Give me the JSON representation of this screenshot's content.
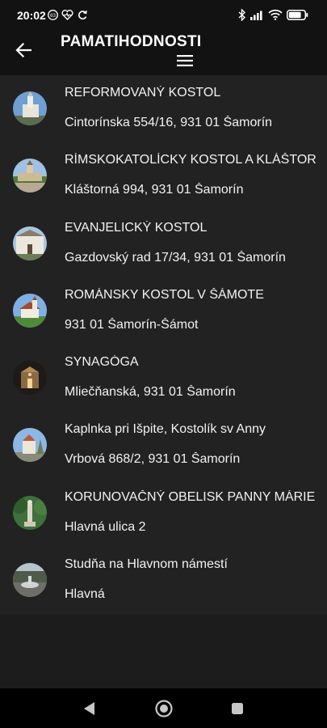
{
  "status_bar": {
    "time": "20:02",
    "notification_badge": "63",
    "battery_level": 0.8,
    "icons": [
      "heart-pulse-icon",
      "sync-icon",
      "bluetooth-icon",
      "signal-icon",
      "wifi-icon",
      "battery-icon"
    ]
  },
  "app_bar": {
    "title": "PAMATIHODNOSTI",
    "back_icon": "arrow-left-icon",
    "menu_icon": "hamburger-menu-icon"
  },
  "places": [
    {
      "name": "REFORMOVANÝ KOSTOL",
      "address": "Cintorínska 554/16, 931 01 Šamorín"
    },
    {
      "name": "RÍMSKOKATOLÍCKY KOSTOL A KLÁŠTOR",
      "address": "Kláštorná 994, 931 01 Šamorín"
    },
    {
      "name": "EVANJELICKÝ KOSTOL",
      "address": "Gazdovský rad 17/34, 931 01 Šamorín"
    },
    {
      "name": "ROMÁNSKY KOSTOL V ŠÁMOTE",
      "address": "931 01 Šamorín-Šámot"
    },
    {
      "name": "SYNAGÓGA",
      "address": "Mliečňanská, 931 01 Šamorín"
    },
    {
      "name": "Kaplnka pri Išpite, Kostolík sv Anny",
      "address": "Vrbová 868/2, 931 01 Šamorín"
    },
    {
      "name": "KORUNOVAČNÝ OBELISK PANNY MÁRIE",
      "address": "Hlavná ulica 2"
    },
    {
      "name": "Studňa na Hlavnom námestí",
      "address": "Hlavná"
    }
  ],
  "nav_bar": {
    "icons": [
      "back-triangle-icon",
      "home-circle-icon",
      "recents-square-icon"
    ]
  },
  "colors": {
    "app_bar": "#121212",
    "list_background": "#222222",
    "page_background": "#1c1c1c",
    "text": "#f2f2f2"
  }
}
